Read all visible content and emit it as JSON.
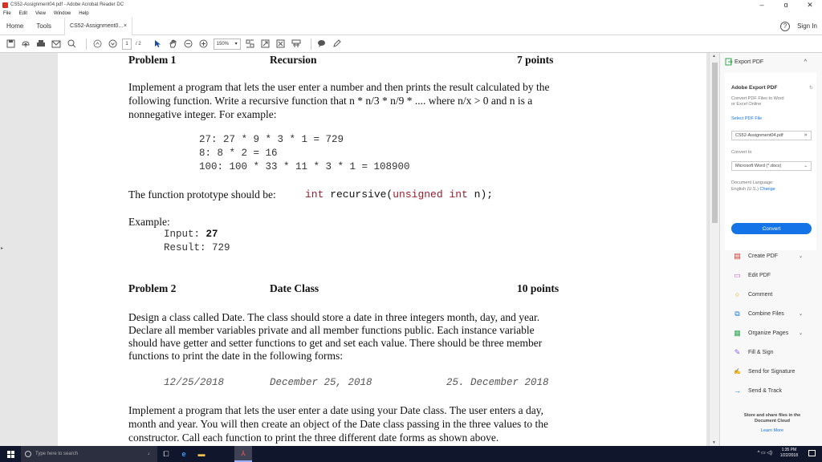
{
  "window": {
    "title": "CS52-Assignment04.pdf - Adobe Acrobat Reader DC",
    "minimize": "–",
    "maximize": "ɑ",
    "close": "✕"
  },
  "menu": [
    "File",
    "Edit",
    "View",
    "Window",
    "Help"
  ],
  "tabs": {
    "home": "Home",
    "tools": "Tools",
    "doc_tab": "CS52-Assignment0...",
    "doc_close": "×",
    "help": "?",
    "signin": "Sign In"
  },
  "toolbar": {
    "page_current": "1",
    "page_total": "/ 2",
    "zoom": "150%"
  },
  "document": {
    "p1_head_left": "Problem 1",
    "p1_head_mid": "Recursion",
    "p1_head_right": "7 points",
    "p1_text_1": "Implement a program that lets the user enter a number and then prints the result calculated by the",
    "p1_text_2": "following function. Write a recursive function that n * n/3 * n/9 * .... where n/x > 0 and n is a",
    "p1_text_3": "nonnegative integer. For example:",
    "p1_code_1": "27: 27 * 9 * 3 * 1 = 729",
    "p1_code_2": "8: 8 * 2 = 16",
    "p1_code_3": "100: 100 * 33 * 11 * 3 * 1 = 108900",
    "proto_label": "The function prototype should be:",
    "proto_int": "int",
    "proto_fn": " recursive(",
    "proto_unsigned": "unsigned int",
    "proto_end": " n);",
    "example_label": "Example:",
    "input_label": "Input: ",
    "input_value": "27",
    "result_label": "Result: ",
    "result_value": "729",
    "p2_head_left": "Problem 2",
    "p2_head_mid": "Date Class",
    "p2_head_right": "10 points",
    "p2_text_1": "Design a class called Date. The class should store a date in three integers month, day, and year.",
    "p2_text_2": "Declare all member variables private and all member functions public. Each instance variable",
    "p2_text_3": "should have getter and setter functions to get and set each value. There should be three member",
    "p2_text_4": "functions to print the date in the following forms:",
    "date_form_1": "12/25/2018",
    "date_form_2": "December 25, 2018",
    "date_form_3": "25. December 2018",
    "p2_text_5": "Implement a program that lets the user enter a date using your Date class. The user enters a day,",
    "p2_text_6": "month and year. You will then create an object of the Date class passing in the three values to the",
    "p2_text_7": "constructor. Call each function to print the three different date forms as shown above."
  },
  "right_panel": {
    "export_pdf": "Export PDF",
    "adobe_export_title": "Adobe Export PDF",
    "adobe_export_desc_1": "Convert PDF Files to Word",
    "adobe_export_desc_2": "or Excel Online",
    "select_file_link": "Select PDF File",
    "selected_file": "CS52-Assignment04.pdf",
    "convert_to_label": "Convert to",
    "convert_to_value": "Microsoft Word (*.docx)",
    "doc_language_label": "Document Language:",
    "doc_language_value": "English (U.S.)",
    "change_link": "Change",
    "convert_button": "Convert",
    "tools": [
      {
        "label": "Create PDF",
        "chevron": "⌄"
      },
      {
        "label": "Edit PDF",
        "chevron": ""
      },
      {
        "label": "Comment",
        "chevron": ""
      },
      {
        "label": "Combine Files",
        "chevron": "⌄"
      },
      {
        "label": "Organize Pages",
        "chevron": "⌄"
      },
      {
        "label": "Fill & Sign",
        "chevron": ""
      },
      {
        "label": "Send for Signature",
        "chevron": ""
      },
      {
        "label": "Send & Track",
        "chevron": ""
      }
    ],
    "store_text_1": "Store and share files in the",
    "store_text_2": "Document Cloud",
    "learn_more": "Learn More"
  },
  "taskbar": {
    "search_placeholder": "Type here to search",
    "time": "1:35 PM",
    "date": "1/22/2018"
  }
}
